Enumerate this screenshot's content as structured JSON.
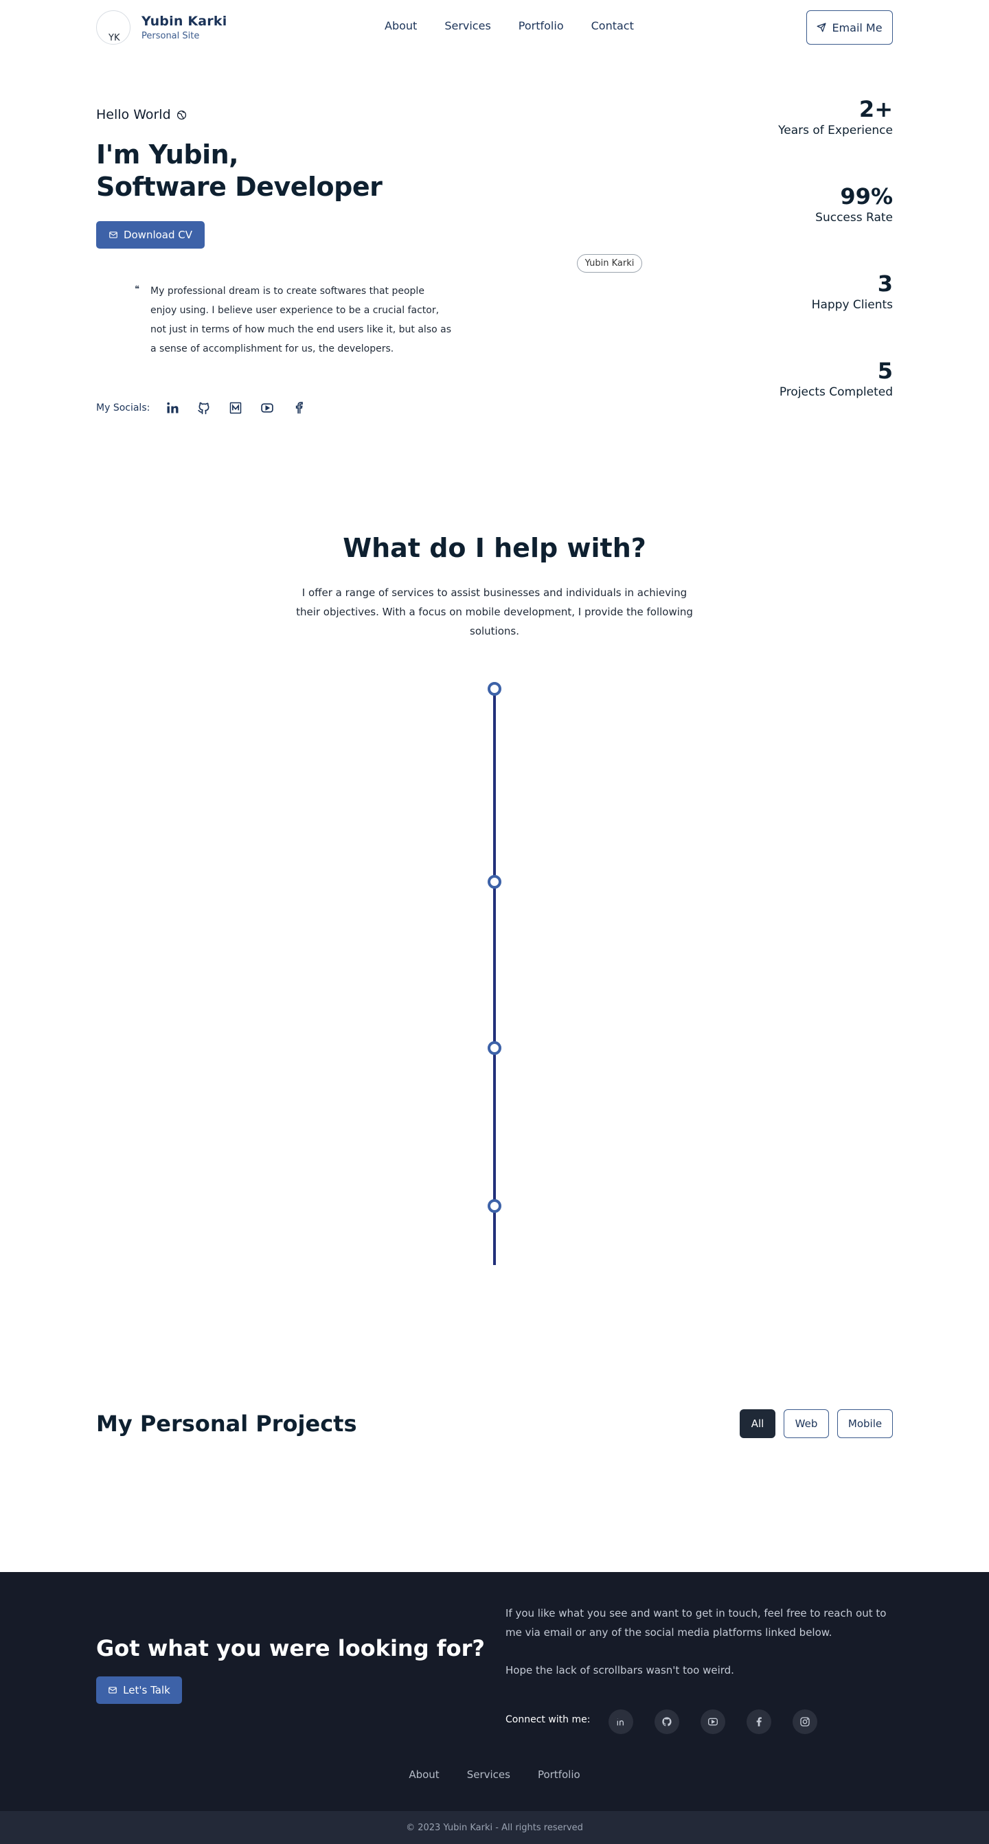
{
  "header": {
    "avatar_text": "YK",
    "brand_name": "Yubin Karki",
    "brand_sub": "Personal Site",
    "nav": [
      "About",
      "Services",
      "Portfolio",
      "Contact"
    ],
    "email_button": "Email Me"
  },
  "hero": {
    "greeting": "Hello World",
    "title_line1": "I'm Yubin,",
    "title_line2": "Software Developer",
    "cv_button": "Download CV",
    "bio": "My professional dream is to create softwares that people enjoy using. I believe user experience to be a crucial factor, not just in terms of how much the end users like it, but also as a sense of accomplishment for us, the developers.",
    "image_alt": "Yubin Karki",
    "socials_label": "My Socials:",
    "socials": [
      "linkedin-icon",
      "github-icon",
      "medium-icon",
      "youtube-icon",
      "facebook-icon"
    ]
  },
  "stats": [
    {
      "value": "2+",
      "label": "Years of Experience"
    },
    {
      "value": "99%",
      "label": "Success Rate"
    },
    {
      "value": "3",
      "label": "Happy Clients"
    },
    {
      "value": "5",
      "label": "Projects Completed"
    }
  ],
  "services": {
    "title": "What do I help with?",
    "description": "I offer a range of services to assist businesses and individuals in achieving their objectives. With a focus on mobile development, I provide the following solutions."
  },
  "projects": {
    "title": "My Personal Projects",
    "filters": [
      "All",
      "Web",
      "Mobile"
    ],
    "active_filter": "All"
  },
  "footer": {
    "cta_title": "Got what you were looking for?",
    "talk_button": "Let's Talk",
    "text1": "If you like what you see and want to get in touch, feel free to reach out to me via email or any of the social media platforms linked below.",
    "text2": "Hope the lack of scrollbars wasn't too weird.",
    "connect_label": "Connect with me:",
    "social_icons": [
      "linkedin-icon",
      "github-icon",
      "youtube-icon",
      "facebook-icon",
      "instagram-icon"
    ],
    "nav": [
      "About",
      "Services",
      "Portfolio"
    ],
    "copyright": "© 2023 Yubin Karki - All rights reserved"
  },
  "colors": {
    "primary": "#3d62a8",
    "navy": "#1b3358",
    "timeline": "#22307a",
    "footer_bg": "#161b28"
  }
}
